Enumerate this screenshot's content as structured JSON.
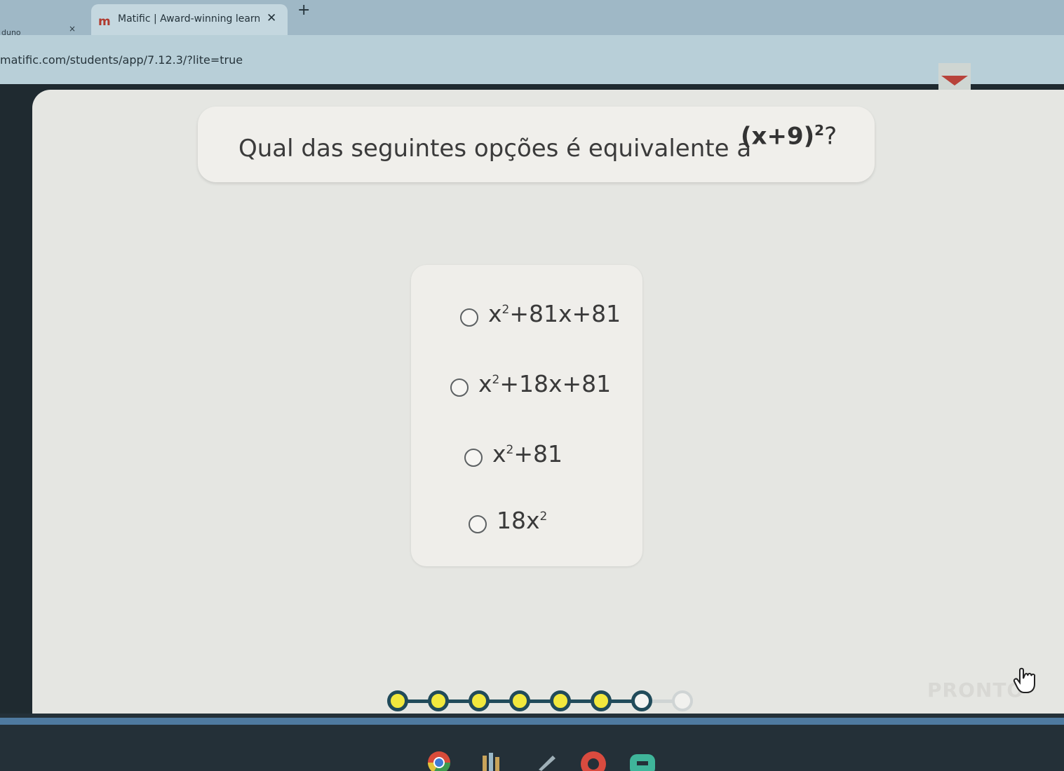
{
  "browser": {
    "prev_tab": {
      "label": "duno",
      "close": "×"
    },
    "active_tab": {
      "favicon": "m",
      "title": "Matific | Award-winning learnin",
      "close": "✕"
    },
    "new_tab": "+",
    "url": "matific.com/students/app/7.12.3/?lite=true",
    "bookmark_icon": "bookmark-ribbon-icon"
  },
  "question": {
    "text": "Qual das seguintes opções é equivalente a",
    "expr_base": "(x+9)",
    "expr_exp": "2",
    "mark": "?"
  },
  "options": [
    {
      "pre": "x",
      "exp": "2",
      "post": "+81x+81"
    },
    {
      "pre": "x",
      "exp": "2",
      "post": "+18x+81"
    },
    {
      "pre": "x",
      "exp": "2",
      "post": "+81"
    },
    {
      "pre": "18x",
      "exp": "2",
      "post": ""
    }
  ],
  "progress": {
    "total_steps": 8,
    "completed_steps": 6,
    "current_step": 7
  },
  "next_button": {
    "label": "PRONTO"
  },
  "colors": {
    "progress_done": "#f2e83d",
    "progress_track": "#214b5a",
    "page_bg": "#e5e6e2"
  },
  "taskbar": [
    "chrome-icon",
    "files-icon",
    "pen-icon",
    "red-app-icon",
    "teal-app-icon"
  ]
}
